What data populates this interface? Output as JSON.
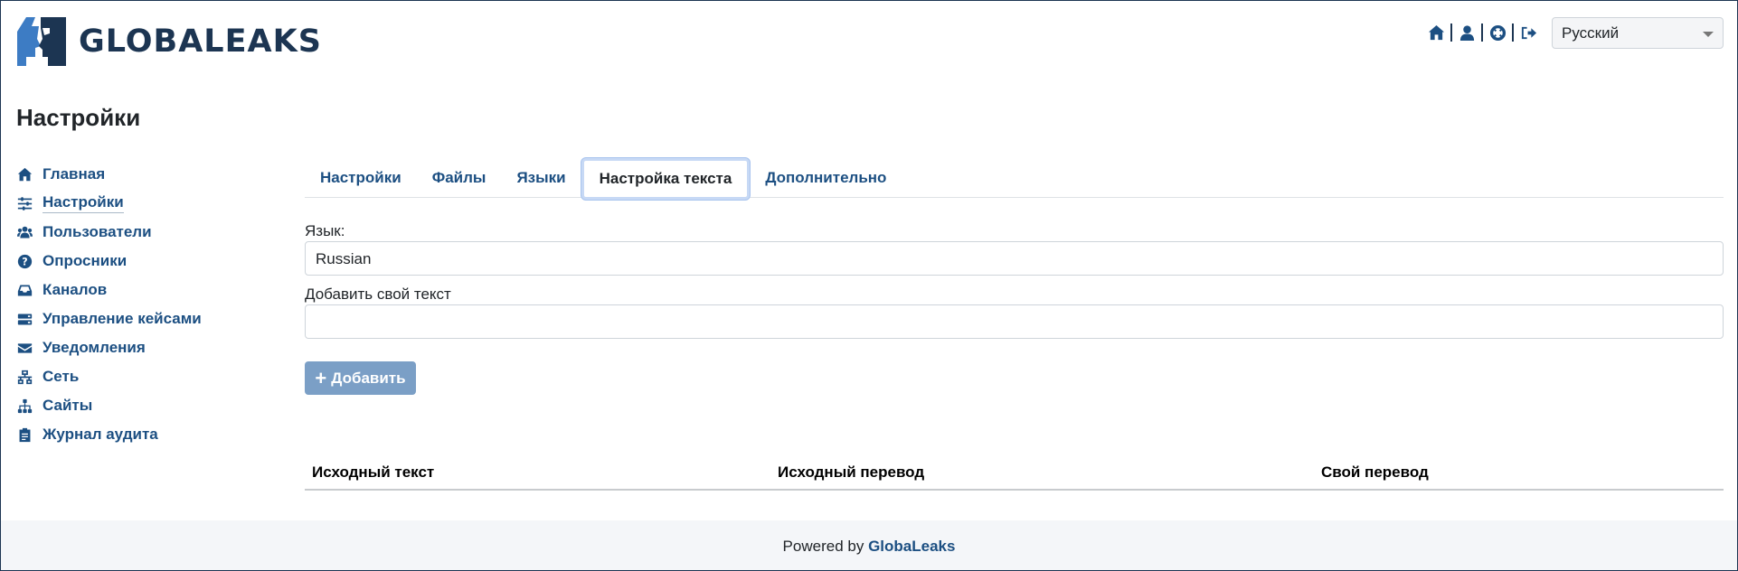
{
  "header": {
    "brand": "GLOBALEAKS",
    "icons": [
      "home-icon",
      "user-icon",
      "support-icon",
      "logout-icon"
    ],
    "language_select": {
      "value": "Русский"
    }
  },
  "page": {
    "title": "Настройки"
  },
  "sidebar": {
    "items": [
      {
        "label": "Главная",
        "icon": "home-icon"
      },
      {
        "label": "Настройки",
        "icon": "sliders-icon",
        "active": true
      },
      {
        "label": "Пользователи",
        "icon": "users-icon"
      },
      {
        "label": "Опросники",
        "icon": "question-circle-icon"
      },
      {
        "label": "Каналов",
        "icon": "inbox-icon"
      },
      {
        "label": "Управление кейсами",
        "icon": "server-icon"
      },
      {
        "label": "Уведомления",
        "icon": "envelope-icon"
      },
      {
        "label": "Сеть",
        "icon": "network-icon"
      },
      {
        "label": "Сайты",
        "icon": "sitemap-icon"
      },
      {
        "label": "Журнал аудита",
        "icon": "clipboard-icon"
      }
    ]
  },
  "tabs": [
    {
      "label": "Настройки"
    },
    {
      "label": "Файлы"
    },
    {
      "label": "Языки"
    },
    {
      "label": "Настройка текста",
      "active": true
    },
    {
      "label": "Дополнительно"
    }
  ],
  "form": {
    "language_label": "Язык:",
    "language_value": "Russian",
    "custom_text_label": "Добавить свой текст",
    "custom_text_value": "",
    "add_button_label": "Добавить"
  },
  "table": {
    "columns": [
      "Исходный текст",
      "Исходный перевод",
      "Свой перевод"
    ]
  },
  "footer": {
    "prefix": "Powered by",
    "link": "GlobaLeaks"
  },
  "colors": {
    "brand": "#1c3552",
    "link": "#1c4f82",
    "button": "#7b9fc6"
  }
}
